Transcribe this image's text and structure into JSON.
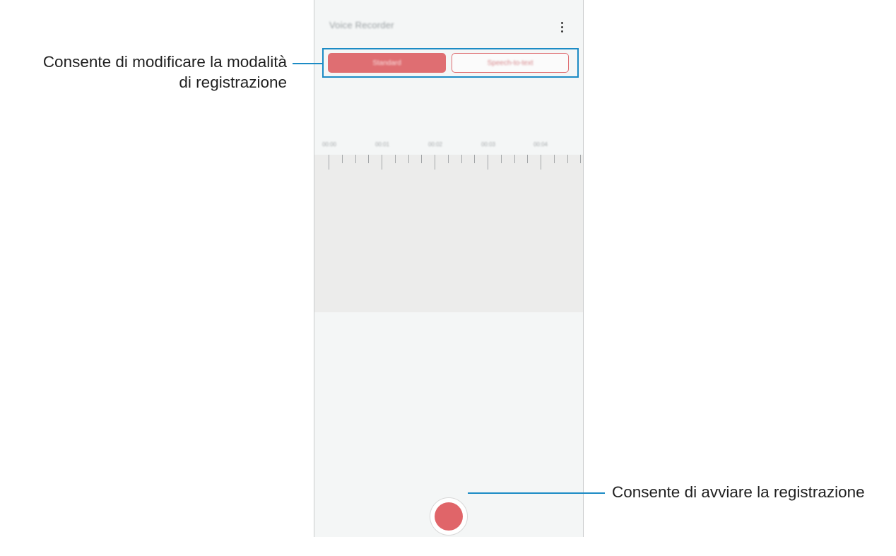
{
  "app": {
    "title": "Voice Recorder",
    "more_icon": "more-vertical-icon"
  },
  "modes": {
    "standard_label": "Standard",
    "speech_to_text_label": "Speech-to-text"
  },
  "timeline": {
    "labels": [
      "00:00",
      "00:01",
      "00:02",
      "00:03",
      "00:04"
    ]
  },
  "record_button": {
    "icon": "record-icon",
    "color": "#e06569"
  },
  "callouts": {
    "mode_line1": "Consente di modificare la modalità",
    "mode_line2": "di registrazione",
    "record": "Consente di avviare la registrazione"
  },
  "colors": {
    "accent": "#df6e72",
    "callout_line": "#1c8bc5"
  }
}
